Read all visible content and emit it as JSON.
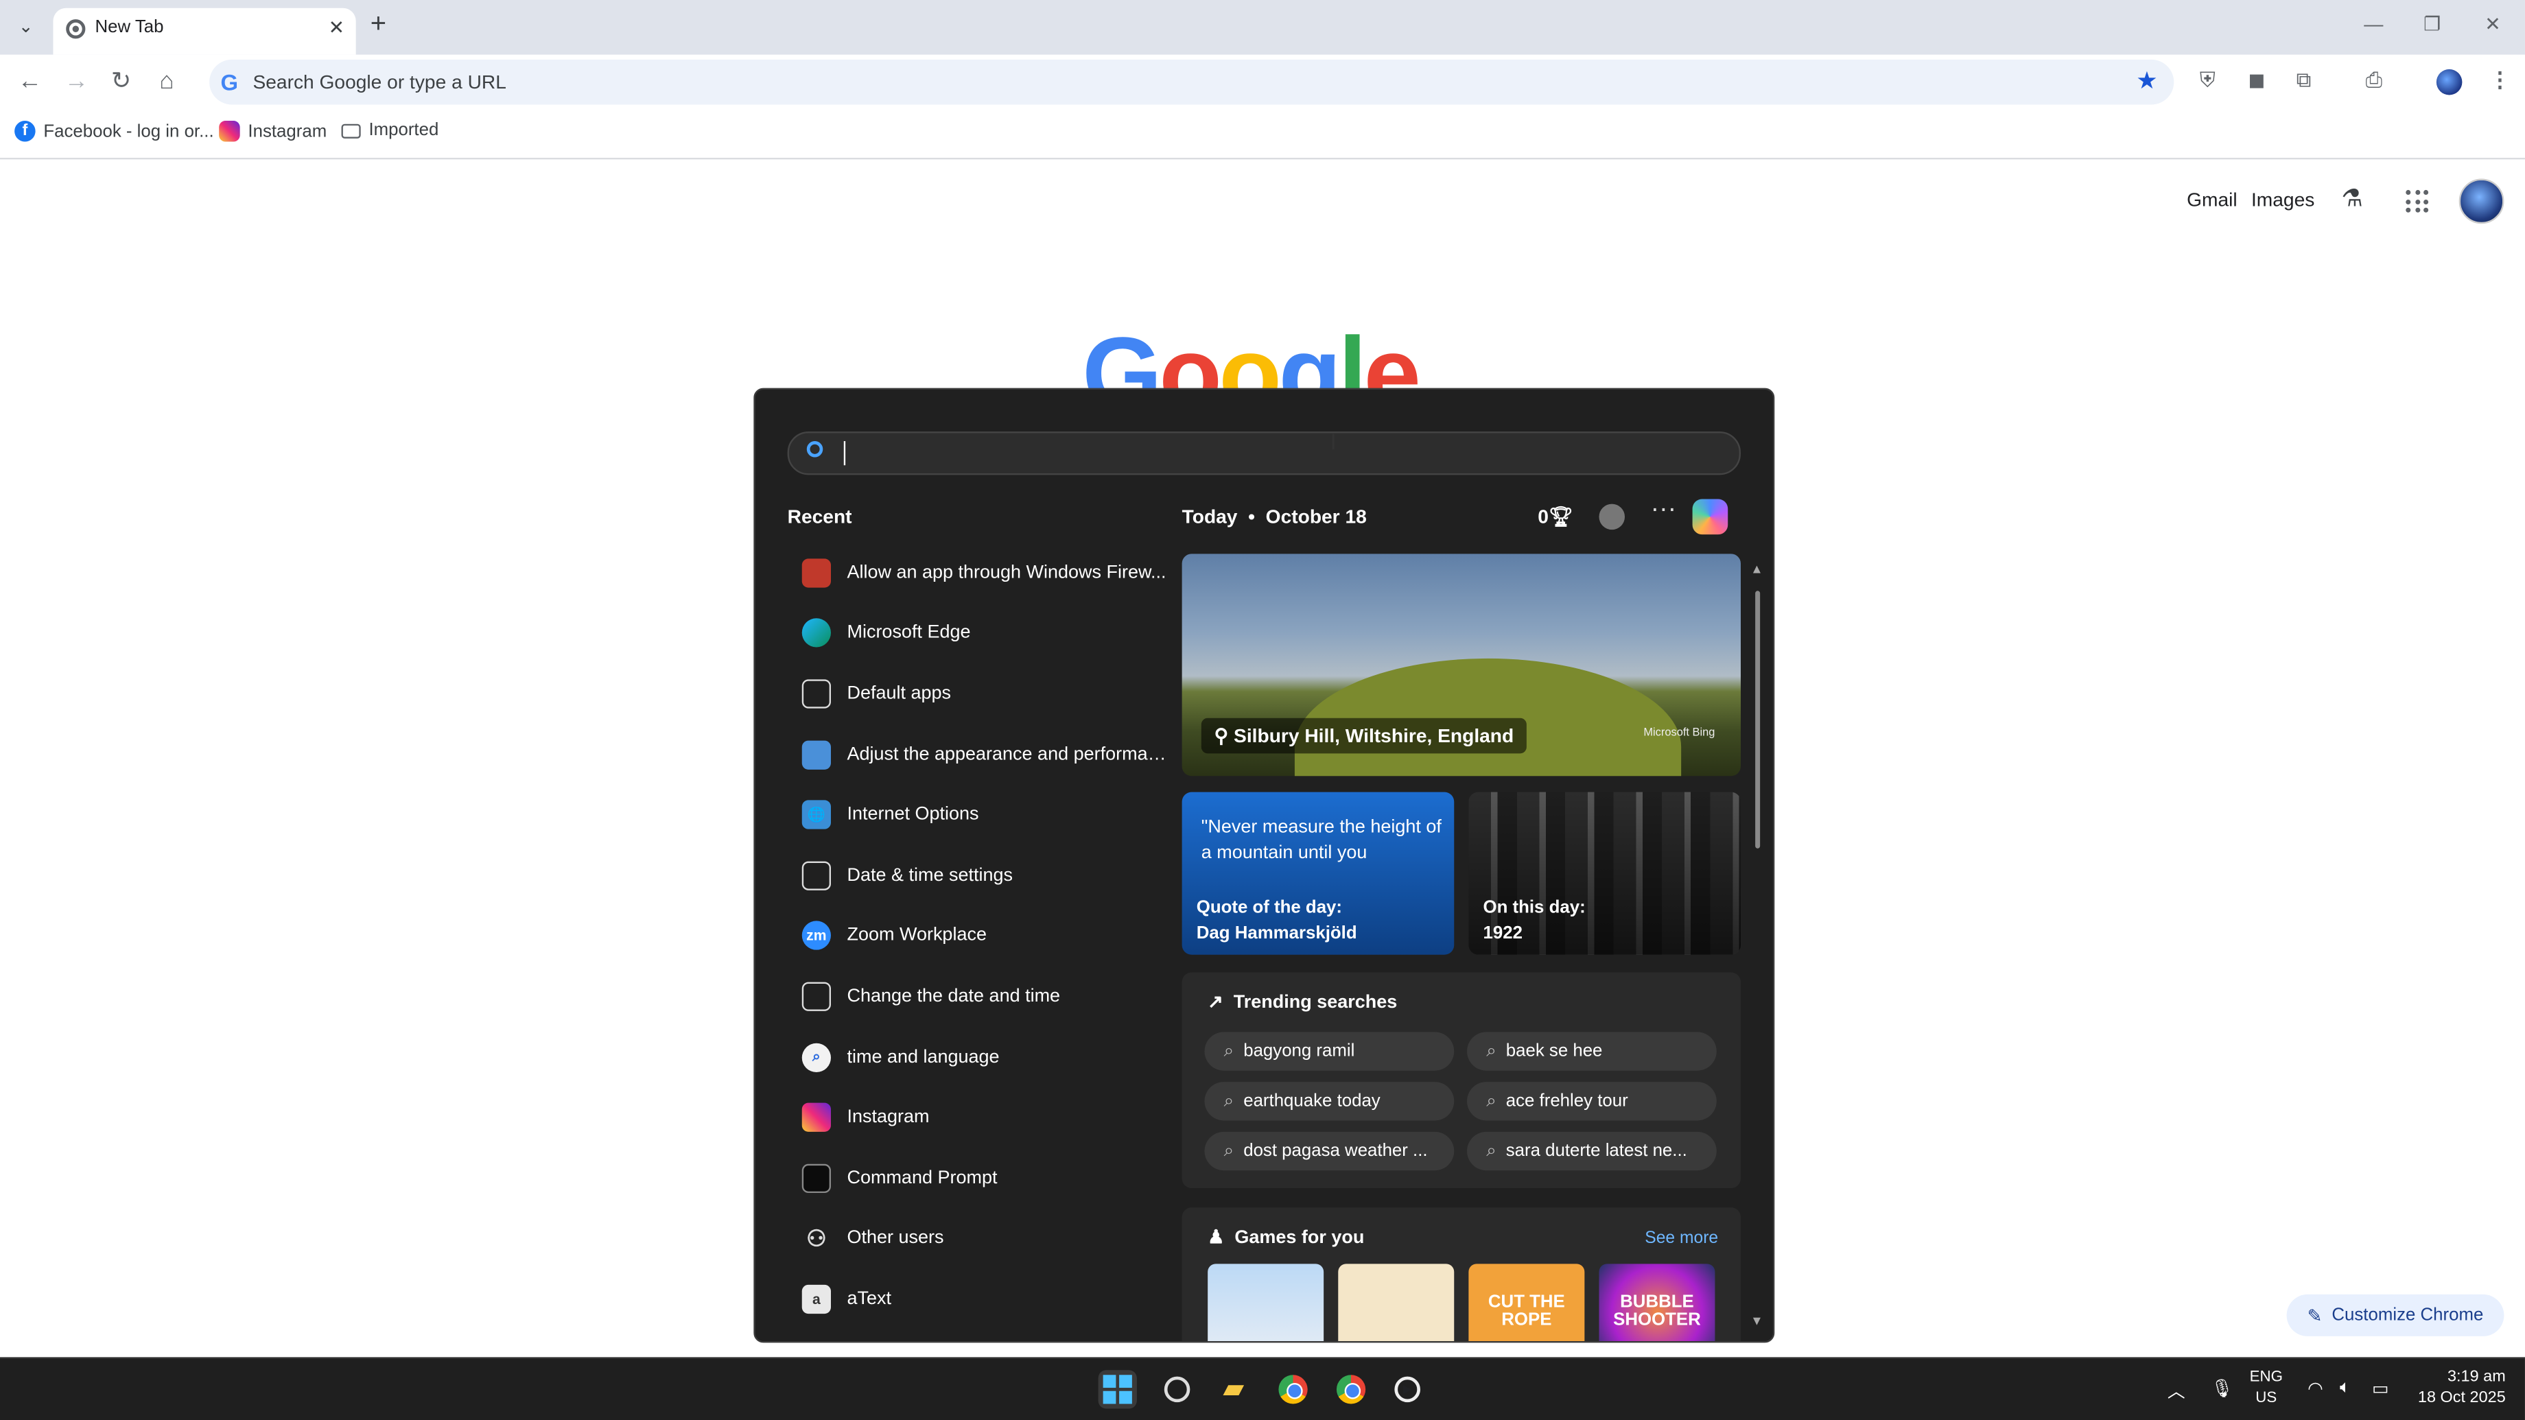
{
  "browser": {
    "tab_title": "New Tab",
    "omnibox_placeholder": "Search Google or type a URL",
    "bookmarks": [
      "Facebook - log in or...",
      "Instagram",
      "Imported"
    ]
  },
  "ntp": {
    "links": [
      "Gmail",
      "Images"
    ],
    "logo_letters": [
      "G",
      "o",
      "o",
      "g",
      "l",
      "e"
    ],
    "customize_label": "Customize Chrome"
  },
  "start_panel": {
    "recent_title": "Recent",
    "recent": [
      "Allow an app through Windows Firew...",
      "Microsoft Edge",
      "Default apps",
      "Adjust the appearance and performan...",
      "Internet Options",
      "Date & time settings",
      "Zoom Workplace",
      "Change the date and time",
      "time and language",
      "Instagram",
      "Command Prompt",
      "Other users",
      "aText"
    ],
    "today_label": "Today",
    "date": "October 18",
    "points": "0",
    "hero": {
      "location": "Silbury Hill, Wiltshire, England",
      "credit": "Microsoft Bing"
    },
    "quote": {
      "text": "\"Never measure the height of a mountain until you",
      "label": "Quote of the day:",
      "author": "Dag Hammarskjöld"
    },
    "on_this_day": {
      "label": "On this day:",
      "year": "1922"
    },
    "trending": {
      "title": "Trending searches",
      "items": [
        "bagyong ramil",
        "baek se hee",
        "earthquake today",
        "ace frehley tour",
        "dost pagasa weather ...",
        "sara duterte latest ne..."
      ]
    },
    "games": {
      "title": "Games for you",
      "see_more": "See more",
      "tiles": [
        "",
        "",
        "CUT THE ROPE",
        "BUBBLE SHOOTER"
      ]
    }
  },
  "taskbar": {
    "language": "ENG",
    "region": "US",
    "time": "3:19 am",
    "date": "18 Oct 2025"
  }
}
